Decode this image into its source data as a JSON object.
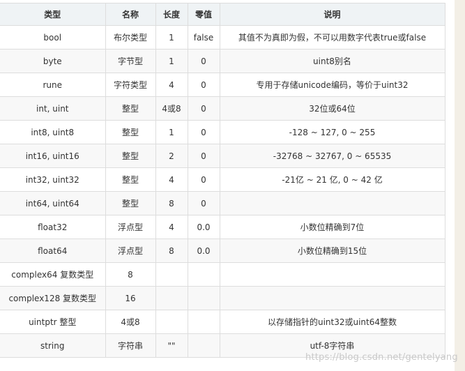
{
  "table": {
    "headers": [
      "类型",
      "名称",
      "长度",
      "零值",
      "说明"
    ],
    "rows": [
      {
        "type": "bool",
        "name": "布尔类型",
        "length": "1",
        "zero": "false",
        "desc": "其值不为真即为假，不可以用数字代表true或false"
      },
      {
        "type": "byte",
        "name": "字节型",
        "length": "1",
        "zero": "0",
        "desc": "uint8别名"
      },
      {
        "type": "rune",
        "name": "字符类型",
        "length": "4",
        "zero": "0",
        "desc": "专用于存储unicode编码，等价于uint32"
      },
      {
        "type": "int, uint",
        "name": "整型",
        "length": "4或8",
        "zero": "0",
        "desc": "32位或64位"
      },
      {
        "type": "int8, uint8",
        "name": "整型",
        "length": "1",
        "zero": "0",
        "desc": "-128 ~ 127, 0 ~ 255"
      },
      {
        "type": "int16, uint16",
        "name": "整型",
        "length": "2",
        "zero": "0",
        "desc": "-32768 ~ 32767, 0 ~ 65535"
      },
      {
        "type": "int32, uint32",
        "name": "整型",
        "length": "4",
        "zero": "0",
        "desc": "-21亿 ~ 21 亿, 0 ~ 42 亿"
      },
      {
        "type": "int64, uint64",
        "name": "整型",
        "length": "8",
        "zero": "0",
        "desc": ""
      },
      {
        "type": "float32",
        "name": "浮点型",
        "length": "4",
        "zero": "0.0",
        "desc": "小数位精确到7位"
      },
      {
        "type": "float64",
        "name": "浮点型",
        "length": "8",
        "zero": "0.0",
        "desc": "小数位精确到15位"
      },
      {
        "type": "complex64 复数类型",
        "name": "8",
        "length": "",
        "zero": "",
        "desc": ""
      },
      {
        "type": "complex128 复数类型",
        "name": "16",
        "length": "",
        "zero": "",
        "desc": ""
      },
      {
        "type": "uintptr 整型",
        "name": "4或8",
        "length": "",
        "zero": "",
        "desc": "以存储指针的uint32或uint64整数"
      },
      {
        "type": "string",
        "name": "字符串",
        "length": "\"\"",
        "zero": "",
        "desc": "utf-8字符串"
      }
    ]
  },
  "watermark": "https://blog.csdn.net/gentelyang"
}
